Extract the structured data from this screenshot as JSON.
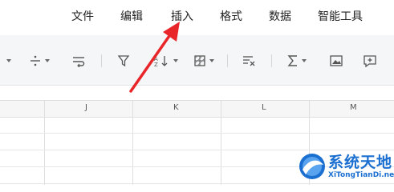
{
  "menu": {
    "items": [
      "文件",
      "编辑",
      "插入",
      "格式",
      "数据",
      "智能工具"
    ]
  },
  "toolbar": {
    "icons": [
      "decimal-icon",
      "wrap-text-icon",
      "filter-icon",
      "sort-icon",
      "cell-style-icon",
      "clear-format-icon",
      "sum-icon",
      "image-icon",
      "comment-icon"
    ]
  },
  "sheet": {
    "columns": [
      "J",
      "K",
      "L",
      "M"
    ]
  },
  "watermark": {
    "title": "系统天地",
    "subtitle": "XiTongTianDi.net"
  },
  "annotation": {
    "arrow_color": "#e8262a"
  }
}
